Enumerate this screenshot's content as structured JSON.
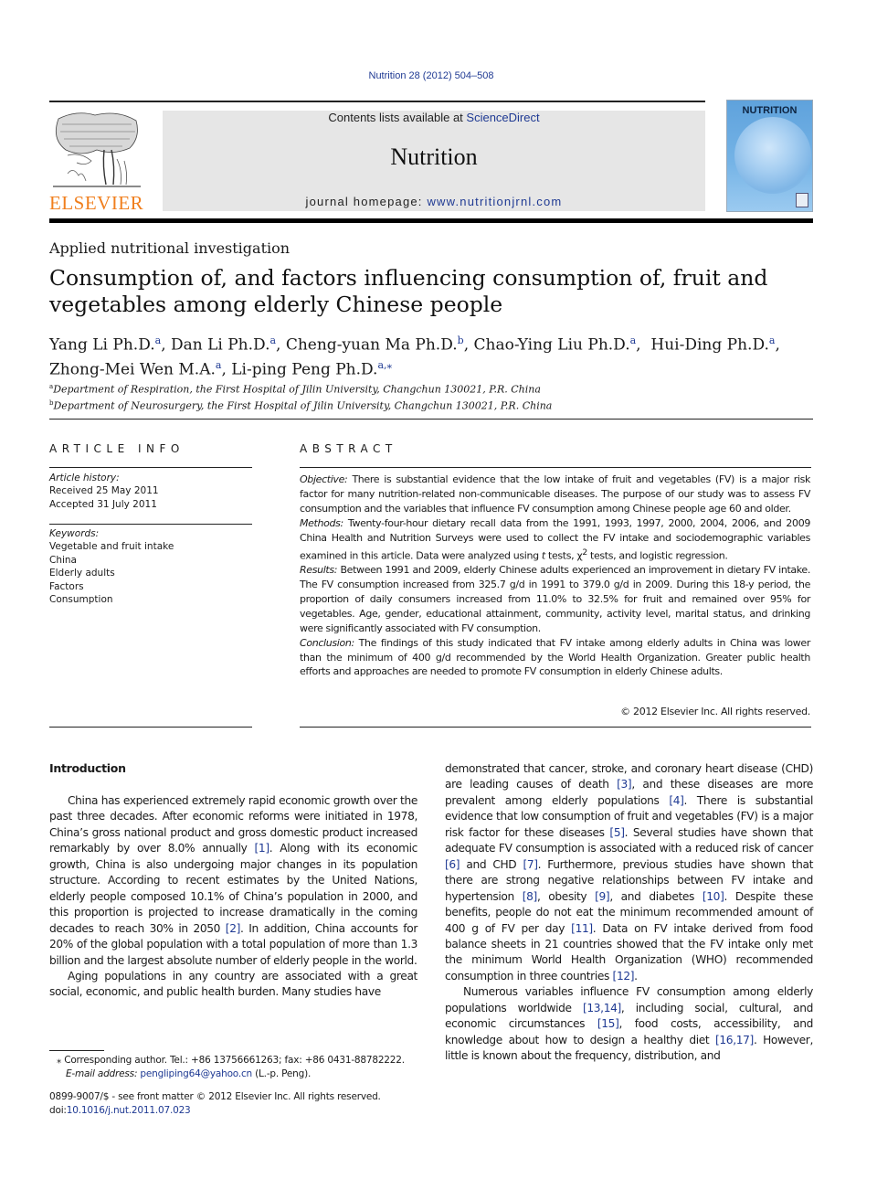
{
  "header": {
    "citation": "Nutrition 28 (2012) 504–508",
    "contents_prefix": "Contents lists available at ",
    "contents_link": "ScienceDirect",
    "journal_name": "Nutrition",
    "homepage_prefix": "journal homepage: ",
    "homepage_link": "www.nutritionjrnl.com",
    "publisher_logo_text": "ELSEVIER",
    "cover_title": "NUTRITION",
    "colors": {
      "link": "#1f3a93",
      "publisher_orange": "#f07f1e",
      "banner_bg": "#e6e6e6",
      "cover_blue": "#6aaae0"
    }
  },
  "article": {
    "section_type": "Applied nutritional investigation",
    "title": "Consumption of, and factors influencing consumption of, fruit and vegetables among elderly Chinese people",
    "authors": [
      {
        "name": "Yang Li Ph.D.",
        "aff": "a"
      },
      {
        "name": "Dan Li Ph.D.",
        "aff": "a"
      },
      {
        "name": "Cheng-yuan Ma Ph.D.",
        "aff": "b"
      },
      {
        "name": "Chao-Ying Liu Ph.D.",
        "aff": "a"
      },
      {
        "name": "Hui-Ding Ph.D.",
        "aff": "a"
      },
      {
        "name": "Zhong-Mei Wen M.A.",
        "aff": "a"
      },
      {
        "name": "Li-ping Peng Ph.D.",
        "aff": "a,⁎"
      }
    ],
    "affiliations": [
      {
        "key": "a",
        "text": "Department of Respiration, the First Hospital of Jilin University, Changchun 130021, P.R. China"
      },
      {
        "key": "b",
        "text": "Department of Neurosurgery, the First Hospital of Jilin University, Changchun 130021, P.R. China"
      }
    ]
  },
  "article_info": {
    "heading": "ARTICLE INFO",
    "history_label": "Article history:",
    "received": "Received 25 May 2011",
    "accepted": "Accepted 31 July 2011",
    "keywords_label": "Keywords:",
    "keywords": [
      "Vegetable and fruit intake",
      "China",
      "Elderly adults",
      "Factors",
      "Consumption"
    ]
  },
  "abstract": {
    "heading": "ABSTRACT",
    "sections": [
      {
        "label": "Objective:",
        "text": " There is substantial evidence that the low intake of fruit and vegetables (FV) is a major risk factor for many nutrition-related non-communicable diseases. The purpose of our study was to assess FV consumption and the variables that influence FV consumption among Chinese people age 60 and older."
      },
      {
        "label": "Methods:",
        "text_before": " Twenty-four-hour dietary recall data from the 1991, 1993, 1997, 2000, 2004, 2006, and 2009 China Health and Nutrition Surveys were used to collect the FV intake and sociodemographic variables examined in this article. Data were analyzed using ",
        "t": "t",
        "text_mid": " tests, χ",
        "sup": "2",
        "text_after": " tests, and logistic regression."
      },
      {
        "label": "Results:",
        "text": " Between 1991 and 2009, elderly Chinese adults experienced an improvement in dietary FV intake. The FV consumption increased from 325.7 g/d in 1991 to 379.0 g/d in 2009. During this 18-y period, the proportion of daily consumers increased from 11.0% to 32.5% for fruit and remained over 95% for vegetables. Age, gender, educational attainment, community, activity level, marital status, and drinking were significantly associated with FV consumption."
      },
      {
        "label": "Conclusion:",
        "text": " The findings of this study indicated that FV intake among elderly adults in China was lower than the minimum of 400 g/d recommended by the World Health Organization. Greater public health efforts and approaches are needed to promote FV consumption in elderly Chinese adults."
      }
    ],
    "copyright": "© 2012 Elsevier Inc. All rights reserved."
  },
  "body": {
    "intro_heading": "Introduction",
    "left": [
      [
        {
          "t": "China has experienced extremely rapid economic growth over the past three decades. After economic reforms were initi­ated in 1978, China’s gross national product and gross domestic product increased remarkably by over 8.0% annually "
        },
        {
          "ref": "[1]"
        },
        {
          "t": ". Along with its economic growth, China is also undergoing major changes in its population structure. According to recent esti­mates by the United Nations, elderly people composed 10.1% of China’s population in 2000, and this proportion is projected to increase dramatically in the coming decades to reach 30% in 2050 "
        },
        {
          "ref": "[2]"
        },
        {
          "t": ". In addition, China accounts for 20% of the global pop­ulation with a total population of more than 1.3 billion and the largest absolute number of elderly people in the world."
        }
      ],
      [
        {
          "t": "Aging populations in any country are associated with a great social, economic, and public health burden. Many studies have"
        }
      ]
    ],
    "right": [
      [
        {
          "t": "demonstrated that cancer, stroke, and coronary heart disease (CHD) are leading causes of death "
        },
        {
          "ref": "[3]"
        },
        {
          "t": ", and these diseases are more prevalent among elderly populations "
        },
        {
          "ref": "[4]"
        },
        {
          "t": ". There is substantial evidence that low consumption of fruit and vegeta­bles (FV) is a major risk factor for these diseases "
        },
        {
          "ref": "[5]"
        },
        {
          "t": ". Several studies have shown that adequate FV consumption is associated with a reduced risk of cancer "
        },
        {
          "ref": "[6]"
        },
        {
          "t": " and CHD "
        },
        {
          "ref": "[7]"
        },
        {
          "t": ". Furthermore, previous studies have shown that there are strong negative relationships between FV intake and hypertension "
        },
        {
          "ref": "[8]"
        },
        {
          "t": ", obesity "
        },
        {
          "ref": "[9]"
        },
        {
          "t": ", and diabetes "
        },
        {
          "ref": "[10]"
        },
        {
          "t": ". Despite these benefits, people do not eat the minimum recommended amount of 400 g of FV per day "
        },
        {
          "ref": "[11]"
        },
        {
          "t": ". Data on FV intake derived from food balance sheets in 21 countries showed that the FV intake only met the minimum World Health Organization (WHO) recommended consumption in three countries "
        },
        {
          "ref": "[12]"
        },
        {
          "t": "."
        }
      ],
      [
        {
          "t": "Numerous variables influence FV consumption among elderly populations worldwide "
        },
        {
          "ref": "[13,14]"
        },
        {
          "t": ", including social, cultural, and economic circumstances "
        },
        {
          "ref": "[15]"
        },
        {
          "t": ", food costs, accessibility, and knowledge about how to design a healthy diet "
        },
        {
          "ref": "[16,17]"
        },
        {
          "t": ". However, little is known about the frequency, distribution, and"
        }
      ]
    ]
  },
  "footnote": {
    "marker": "⁎",
    "corresponding": " Corresponding author. Tel.: +86 13756661263; fax: +86 0431-88782222.",
    "email_label": "E-mail address:",
    "email": "pengliping64@yahoo.cn",
    "email_suffix": " (L.-p. Peng)."
  },
  "front_matter": {
    "issn_line": "0899-9007/$ - see front matter © 2012 Elsevier Inc. All rights reserved.",
    "doi_prefix": "doi:",
    "doi": "10.1016/j.nut.2011.07.023"
  }
}
